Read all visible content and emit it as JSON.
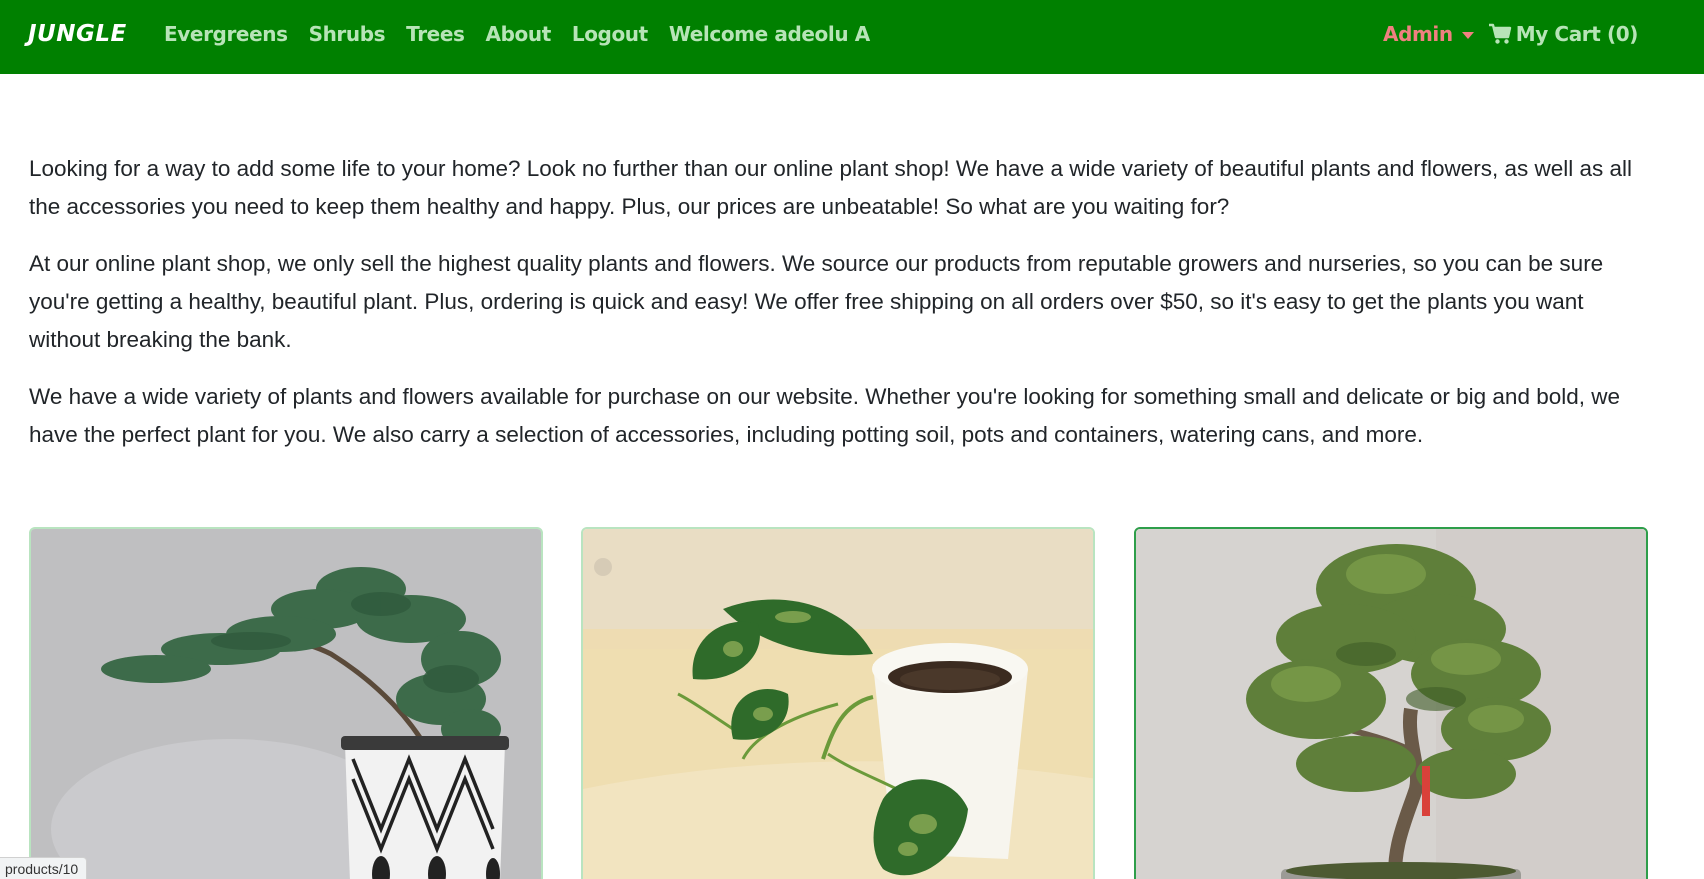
{
  "navbar": {
    "brand": "JUNGLE",
    "links": [
      "Evergreens",
      "Shrubs",
      "Trees",
      "About",
      "Logout",
      "Welcome adeolu A"
    ],
    "admin_label": "Admin",
    "cart_label": "My Cart (0)",
    "cart_icon": "shopping-cart-icon",
    "colors": {
      "background": "#008000",
      "link": "#b7e4b7",
      "admin": "#f08080",
      "brand": "#ffffff"
    }
  },
  "intro": {
    "paragraphs": [
      "Looking for a way to add some life to your home? Look no further than our online plant shop! We have a wide variety of beautiful plants and flowers, as well as all the accessories you need to keep them healthy and happy. Plus, our prices are unbeatable! So what are you waiting for?",
      "At our online plant shop, we only sell the highest quality plants and flowers. We source our products from reputable growers and nurseries, so you can be sure you're getting a healthy, beautiful plant. Plus, ordering is quick and easy! We offer free shipping on all orders over $50, so it's easy to get the plants you want without breaking the bank.",
      "We have a wide variety of plants and flowers available for purchase on our website. Whether you're looking for something small and delicate or big and bold, we have the perfect plant for you. We also carry a selection of accessories, including potting soil, pots and containers, watering cans, and more."
    ]
  },
  "products": [
    {
      "image": "juniper-bonsai-in-patterned-pot"
    },
    {
      "image": "pothos-cutting-in-white-pot"
    },
    {
      "image": "bonsai-tree-in-tray"
    }
  ],
  "status_bar": {
    "url": "products/10"
  }
}
